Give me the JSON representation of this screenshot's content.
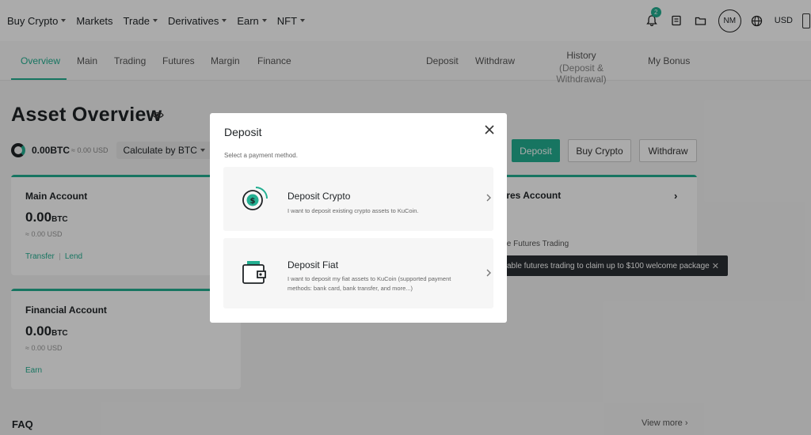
{
  "topnav": {
    "menu": [
      {
        "label": "Buy Crypto",
        "caret": true
      },
      {
        "label": "Markets",
        "caret": false
      },
      {
        "label": "Trade",
        "caret": true
      },
      {
        "label": "Derivatives",
        "caret": true
      },
      {
        "label": "Earn",
        "caret": true
      },
      {
        "label": "NFT",
        "caret": true
      }
    ],
    "notification_count": "2",
    "avatar_initials": "NM",
    "currency": "USD"
  },
  "subnav": {
    "tabs": [
      "Overview",
      "Main",
      "Trading",
      "Futures",
      "Margin",
      "Finance"
    ],
    "active_tab": "Overview",
    "right_tabs": [
      "Deposit",
      "Withdraw"
    ],
    "history_line1": "History",
    "history_line2": "(Deposit & Withdrawal)",
    "bonus": "My Bonus"
  },
  "overview": {
    "title": "Asset Overview",
    "balance_btc": "0.00BTC",
    "balance_usd": "≈ 0.00 USD",
    "calc_label": "Calculate by BTC",
    "buttons": {
      "deposit": "Deposit",
      "buy": "Buy Crypto",
      "withdraw": "Withdraw"
    }
  },
  "cards": {
    "main": {
      "title": "Main Account",
      "value": "0.00",
      "unit": "BTC",
      "usd": "≈ 0.00 USD",
      "link1": "Transfer",
      "link2": "Lend"
    },
    "financial": {
      "title": "Financial Account",
      "value": "0.00",
      "unit": "BTC",
      "usd": "≈ 0.00 USD",
      "link1": "Earn"
    },
    "futures": {
      "title": "ures Account",
      "link": "ble Futures Trading"
    }
  },
  "tooltip": {
    "text": "able futures trading to claim up to $100 welcome package"
  },
  "footer": {
    "faq": "FAQ",
    "view_more": "View more"
  },
  "modal": {
    "title": "Deposit",
    "subtitle": "Select a payment method.",
    "options": [
      {
        "title": "Deposit Crypto",
        "desc": "I want to deposit existing crypto assets to KuCoin."
      },
      {
        "title": "Deposit Fiat",
        "desc": "I want to deposit my fiat assets to KuCoin (supported payment methods: bank card, bank transfer, and more...)"
      }
    ]
  },
  "colors": {
    "accent": "#23af91",
    "text": "#1f2326",
    "overlay": "rgba(0,0,0,0.33)"
  },
  "icons": [
    "bell-icon",
    "orders-icon",
    "folder-icon",
    "globe-icon",
    "download-icon",
    "eye-icon",
    "close-icon",
    "crypto-coin-icon",
    "wallet-icon",
    "chevron-right-icon"
  ]
}
